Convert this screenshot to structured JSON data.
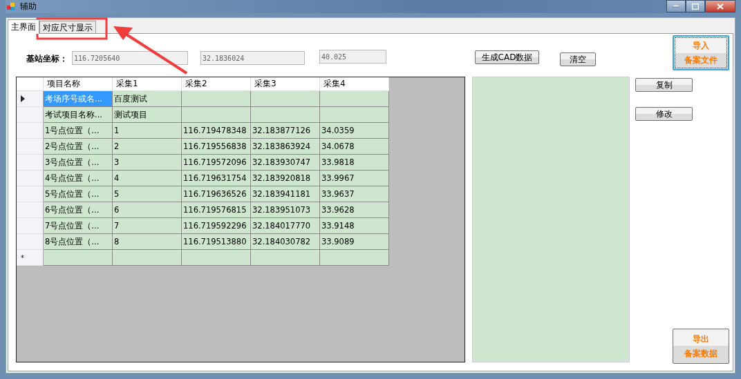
{
  "window": {
    "title": "辅助"
  },
  "tabs": [
    {
      "label": "主界面",
      "selected": true
    },
    {
      "label": "对应尺寸显示",
      "selected": false
    }
  ],
  "station": {
    "label": "基站坐标：",
    "fields": [
      "116.7205640",
      "32.1836024",
      "40.025"
    ]
  },
  "top_buttons": [
    "生成CAD数据",
    "清空"
  ],
  "import_button": {
    "lines": [
      "导入",
      "备案文件"
    ],
    "focused": true
  },
  "side_buttons": [
    "复制",
    "修改"
  ],
  "export_button": {
    "lines": [
      "导出",
      "备案数据"
    ],
    "focused": false
  },
  "grid": {
    "columns": [
      "项目名称",
      "采集1",
      "采集2",
      "采集3",
      "采集4"
    ],
    "rows": [
      {
        "selected": true,
        "cells": [
          "考场序号或名...",
          "百度测试",
          "",
          "",
          ""
        ]
      },
      {
        "selected": false,
        "cells": [
          "考试项目名称...",
          "测试项目",
          "",
          "",
          ""
        ]
      },
      {
        "selected": false,
        "cells": [
          "1号点位置（...",
          "1",
          "116.719478348",
          "32.183877126",
          "34.0359"
        ]
      },
      {
        "selected": false,
        "cells": [
          "2号点位置（...",
          "2",
          "116.719556838",
          "32.183863924",
          "34.0678"
        ]
      },
      {
        "selected": false,
        "cells": [
          "3号点位置（...",
          "3",
          "116.719572096",
          "32.183930747",
          "33.9818"
        ]
      },
      {
        "selected": false,
        "cells": [
          "4号点位置（...",
          "4",
          "116.719631754",
          "32.183920818",
          "33.9967"
        ]
      },
      {
        "selected": false,
        "cells": [
          "5号点位置（...",
          "5",
          "116.719636526",
          "32.183941181",
          "33.9637"
        ]
      },
      {
        "selected": false,
        "cells": [
          "6号点位置（...",
          "6",
          "116.719576815",
          "32.183951073",
          "33.9628"
        ]
      },
      {
        "selected": false,
        "cells": [
          "7号点位置（...",
          "7",
          "116.719592296",
          "32.184017770",
          "33.9148"
        ]
      },
      {
        "selected": false,
        "cells": [
          "8号点位置（...",
          "8",
          "116.719513880",
          "32.184030782",
          "33.9089"
        ]
      }
    ],
    "new_row_marker": "*"
  },
  "annotation": {
    "kind": "arrow"
  }
}
